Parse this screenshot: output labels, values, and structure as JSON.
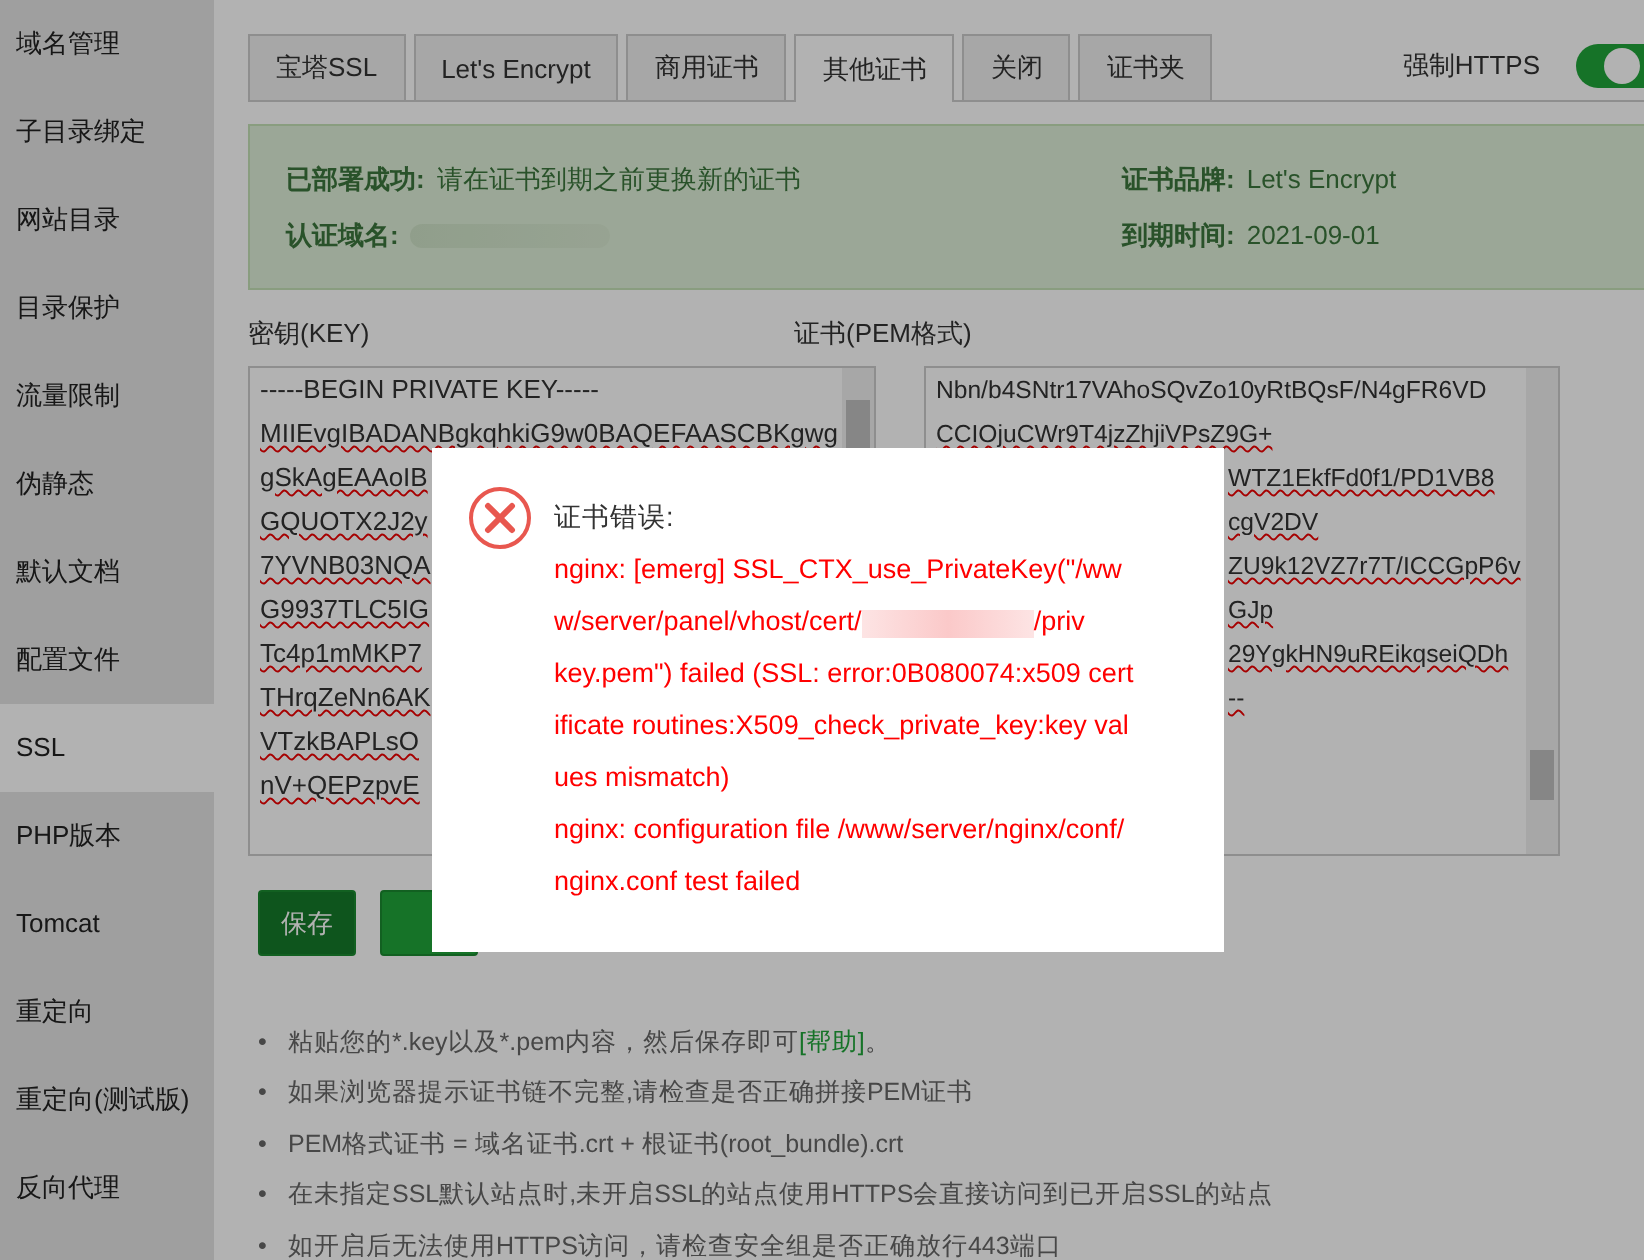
{
  "sidebar": {
    "items": [
      {
        "label": "域名管理",
        "selected": false
      },
      {
        "label": "子目录绑定",
        "selected": false
      },
      {
        "label": "网站目录",
        "selected": false
      },
      {
        "label": "目录保护",
        "selected": false
      },
      {
        "label": "流量限制",
        "selected": false
      },
      {
        "label": "伪静态",
        "selected": false
      },
      {
        "label": "默认文档",
        "selected": false
      },
      {
        "label": "配置文件",
        "selected": false
      },
      {
        "label": "SSL",
        "selected": true
      },
      {
        "label": "PHP版本",
        "selected": false
      },
      {
        "label": "Tomcat",
        "selected": false
      },
      {
        "label": "重定向",
        "selected": false
      },
      {
        "label": "重定向(测试版)",
        "selected": false
      },
      {
        "label": "反向代理",
        "selected": false
      }
    ]
  },
  "tabs": [
    {
      "label": "宝塔SSL",
      "selected": false
    },
    {
      "label": "Let's Encrypt",
      "selected": false
    },
    {
      "label": "商用证书",
      "selected": false
    },
    {
      "label": "其他证书",
      "selected": true
    },
    {
      "label": "关闭",
      "selected": false
    },
    {
      "label": "证书夹",
      "selected": false
    }
  ],
  "force_https": {
    "label": "强制HTTPS",
    "on": true
  },
  "status": {
    "deployed_label": "已部署成功:",
    "deployed_text": "请在证书到期之前更换新的证书",
    "domain_label": "认证域名:",
    "brand_label": "证书品牌:",
    "brand": "Let's Encrypt",
    "expiry_label": "到期时间:",
    "expiry": "2021-09-01"
  },
  "key": {
    "label": "密钥(KEY)",
    "lines": [
      "-----BEGIN PRIVATE KEY-----",
      "MIIEvgIBADANBgkqhkiG9w0BAQEFAASCBKgwg",
      "gSkAgEAAoIB",
      "GQUOTX2J2y",
      "7YVNB03NQA",
      "G9937TLC5IG",
      "Tc4p1mMKP7",
      "THrqZeNn6AK",
      "VTzkBAPLsO",
      "nV+QEPzpvE"
    ]
  },
  "cert": {
    "label": "证书(PEM格式)",
    "lines": [
      {
        "text": "Nbn/b4SNtr17VAhoSQvZo10yRtBQsF/N4gFR6VD",
        "covered": false
      },
      {
        "text": "CCIOjuCWr9T4jzZhjiVPsZ9G+",
        "covered": false
      },
      {
        "text": "WTZ1EkfFd0f1/PD1VB8",
        "covered": true
      },
      {
        "text": "cgV2DV",
        "covered": true
      },
      {
        "text": "ZU9k12VZ7r7T/ICCGpP6v",
        "covered": true
      },
      {
        "text": "GJp",
        "covered": true
      },
      {
        "text": "29YgkHN9uREikqseiQDh",
        "covered": true
      },
      {
        "text": "--",
        "covered": true
      }
    ]
  },
  "buttons": [
    {
      "kind": "save",
      "label": "保存"
    },
    {
      "kind": "close"
    }
  ],
  "notes": [
    {
      "bullet": "•",
      "text": "粘贴您的*.key以及*.pem内容，然后保存即可",
      "link": "[帮助]",
      "after": "。"
    },
    {
      "bullet": "•",
      "text": "如果浏览器提示证书链不完整,请检查是否正确拼接PEM证书"
    },
    {
      "bullet": "•",
      "text": "PEM格式证书 = 域名证书.crt + 根证书(root_bundle).crt"
    },
    {
      "bullet": "•",
      "text": "在未指定SSL默认站点时,未开启SSL的站点使用HTTPS会直接访问到已开启SSL的站点"
    },
    {
      "bullet": "•",
      "text": "如开启后无法使用HTTPS访问，请检查安全组是否正确放行443端口"
    }
  ],
  "dialog": {
    "title": "证书错误:",
    "lines": [
      {
        "text": "nginx: [emerg] SSL_CTX_use_PrivateKey(\"/ww"
      },
      {
        "text": "w/server/panel/vhost/cert/",
        "redacted": true,
        "after": "/priv"
      },
      {
        "text": "key.pem\") failed (SSL: error:0B080074:x509 cert"
      },
      {
        "text": "ificate routines:X509_check_private_key:key val"
      },
      {
        "text": "ues mismatch)"
      },
      {
        "text": "nginx: configuration file /www/server/nginx/conf/"
      },
      {
        "text": "nginx.conf test failed"
      }
    ]
  }
}
